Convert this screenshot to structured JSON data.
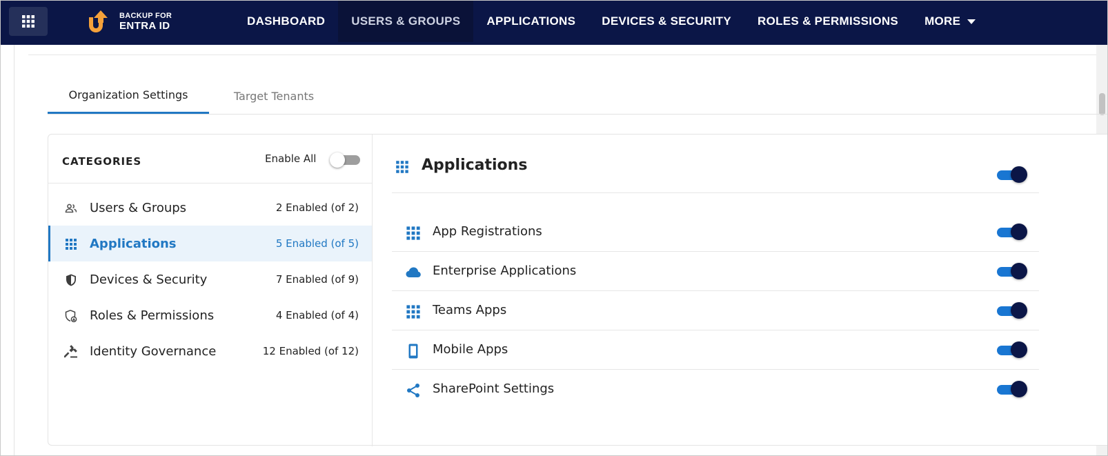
{
  "app": {
    "logo_line1": "BACKUP FOR",
    "logo_line2": "ENTRA ID",
    "brand_orange": "#f5a13a",
    "nav_bg": "#0b1647",
    "accent": "#2178c3"
  },
  "nav": {
    "items": [
      {
        "label": "DASHBOARD"
      },
      {
        "label": "USERS & GROUPS"
      },
      {
        "label": "APPLICATIONS"
      },
      {
        "label": "DEVICES & SECURITY"
      },
      {
        "label": "ROLES & PERMISSIONS"
      },
      {
        "label": "MORE"
      }
    ],
    "active": "USERS & GROUPS"
  },
  "tabs": {
    "items": [
      {
        "label": "Organization Settings"
      },
      {
        "label": "Target Tenants"
      }
    ],
    "active": "Organization Settings"
  },
  "categories": {
    "title": "CATEGORIES",
    "enable_all_label": "Enable All",
    "enable_all_on": false,
    "items": [
      {
        "label": "Users & Groups",
        "count": "2 Enabled (of 2)",
        "icon": "users-icon"
      },
      {
        "label": "Applications",
        "count": "5 Enabled (of 5)",
        "icon": "apps-grid-icon"
      },
      {
        "label": "Devices & Security",
        "count": "7 Enabled (of 9)",
        "icon": "shield-icon"
      },
      {
        "label": "Roles & Permissions",
        "count": "4 Enabled (of 4)",
        "icon": "shield-lock-icon"
      },
      {
        "label": "Identity Governance",
        "count": "12 Enabled (of 12)",
        "icon": "gavel-icon"
      }
    ],
    "active": "Applications"
  },
  "detail": {
    "title": "Applications",
    "enabled": true,
    "items": [
      {
        "label": "App Registrations",
        "icon": "apps-grid-icon",
        "enabled": true
      },
      {
        "label": "Enterprise Applications",
        "icon": "cloud-icon",
        "enabled": true
      },
      {
        "label": "Teams Apps",
        "icon": "apps-grid-icon",
        "enabled": true
      },
      {
        "label": "Mobile Apps",
        "icon": "mobile-phone-icon",
        "enabled": true
      },
      {
        "label": "SharePoint Settings",
        "icon": "share-icon",
        "enabled": true
      }
    ]
  }
}
